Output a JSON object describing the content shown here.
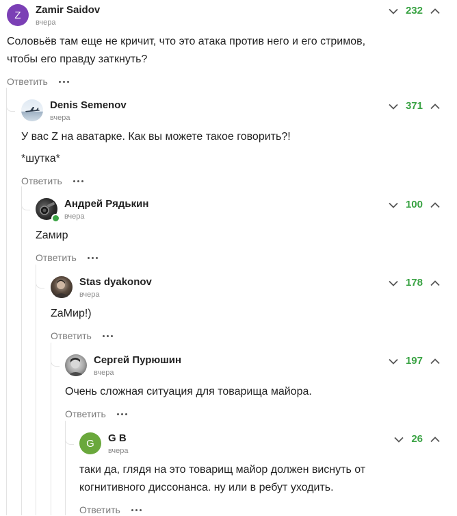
{
  "comments": [
    {
      "author": "Zamir Saidov",
      "time": "вчера",
      "avatar_letter": "Z",
      "avatar_color": "#7b3fb5",
      "score": "232",
      "lines": [
        "Соловьёв там еще не кричит, что это атака против него и его стримов,",
        "чтобы его правду заткнуть?"
      ],
      "reply_label": "Ответить"
    },
    {
      "author": "Denis Semenov",
      "time": "вчера",
      "avatar_letter": "",
      "score": "371",
      "lines": [
        "У вас Z на аватарке. Как вы можете такое говорить?!",
        "*шутка*"
      ],
      "reply_label": "Ответить"
    },
    {
      "author": "Андрей Рядькин",
      "time": "вчера",
      "avatar_letter": "",
      "score": "100",
      "lines": [
        "Zамир"
      ],
      "reply_label": "Ответить",
      "online": true
    },
    {
      "author": "Stas dyakonov",
      "time": "вчера",
      "avatar_letter": "",
      "score": "178",
      "lines": [
        "ZaМир!)"
      ],
      "reply_label": "Ответить"
    },
    {
      "author": "Сергей Пурюшин",
      "time": "вчера",
      "avatar_letter": "",
      "score": "197",
      "lines": [
        "Очень сложная ситуация для товарища майора."
      ],
      "reply_label": "Ответить"
    },
    {
      "author": "G B",
      "time": "вчера",
      "avatar_letter": "G",
      "avatar_color": "#6aa83c",
      "score": "26",
      "lines": [
        "таки да, глядя на это товарищ майор должен виснуть от",
        "когнитивного диссонанса. ну или в ребут уходить."
      ],
      "reply_label": "Ответить"
    }
  ],
  "colors": {
    "score": "#3aa344",
    "muted": "#8a8a8a",
    "thread": "#e3e3e3"
  },
  "icons": {
    "down": "chevron-down-icon",
    "up": "chevron-up-icon",
    "more": "more-dots-icon"
  }
}
